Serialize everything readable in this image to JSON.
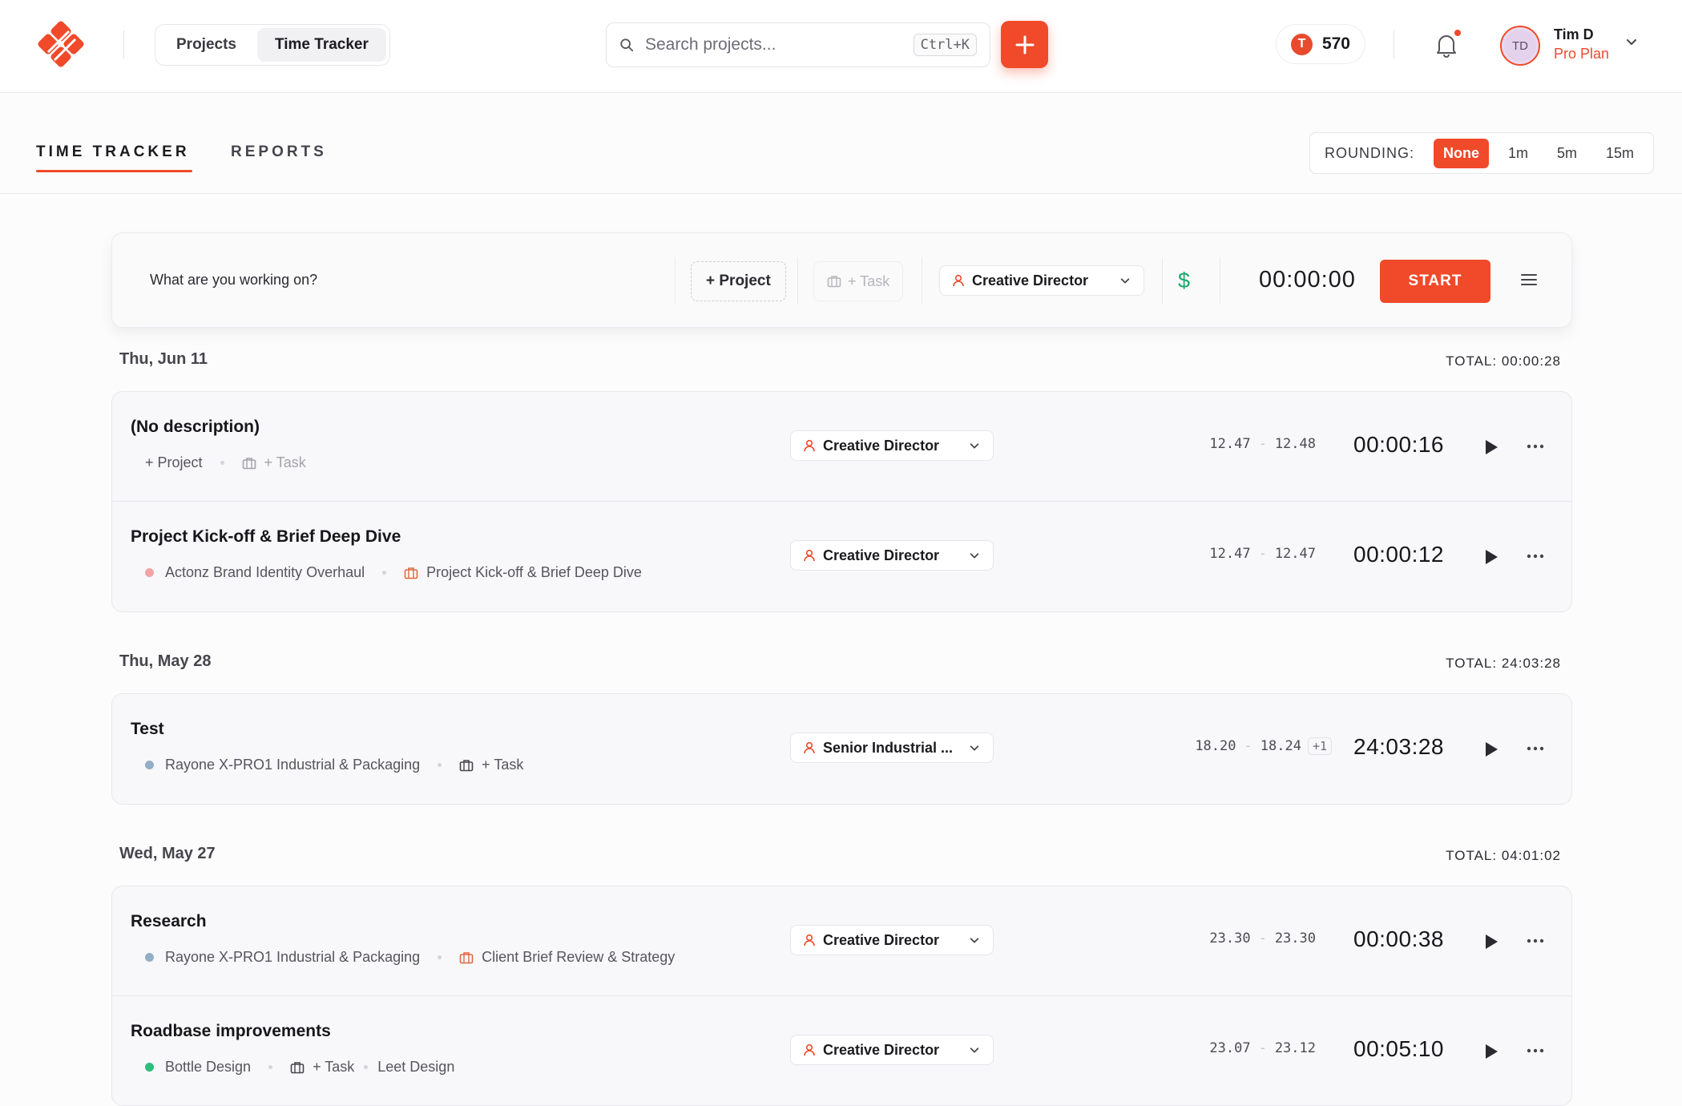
{
  "colors": {
    "accent": "#f04a2a",
    "money": "#1ca66b"
  },
  "header": {
    "nav": [
      {
        "label": "Projects"
      },
      {
        "label": "Time Tracker"
      }
    ],
    "search": {
      "placeholder": "Search projects...",
      "shortcut": "Ctrl+K"
    },
    "coins": {
      "icon": "T",
      "value": "570"
    },
    "user": {
      "initials": "TD",
      "name": "Tim D",
      "plan": "Pro Plan"
    }
  },
  "subnav": {
    "tabs": [
      {
        "label": "TIME TRACKER"
      },
      {
        "label": "REPORTS"
      }
    ],
    "rounding": {
      "label": "ROUNDING:",
      "options": [
        "None",
        "1m",
        "5m",
        "15m"
      ],
      "selected": "None"
    }
  },
  "timer": {
    "prompt": "What are you working on?",
    "project_label": "+ Project",
    "task_label": "+ Task",
    "role": "Creative Director",
    "billable_icon": "$",
    "time": "00:00:00",
    "start_label": "START"
  },
  "groups": [
    {
      "date": "Thu, Jun 11",
      "total": "TOTAL: 00:00:28",
      "entries": [
        {
          "title": "(No description)",
          "project": "+ Project",
          "task": "+ Task",
          "role": "Creative Director",
          "start": "12.47",
          "end": "12.48",
          "duration": "00:00:16"
        },
        {
          "title": "Project Kick-off & Brief Deep Dive",
          "project": "Actonz Brand Identity Overhaul",
          "project_color": "#f1a3a8",
          "task": "Project Kick-off & Brief Deep Dive",
          "role": "Creative Director",
          "start": "12.47",
          "end": "12.47",
          "duration": "00:00:12"
        }
      ]
    },
    {
      "date": "Thu, May 28",
      "total": "TOTAL: 24:03:28",
      "entries": [
        {
          "title": "Test",
          "project": "Rayone X-PRO1 Industrial & Packaging",
          "project_color": "#93aec7",
          "task": "+ Task",
          "role": "Senior Industrial ...",
          "start": "18.20",
          "end": "18.24",
          "extra": "+1",
          "duration": "24:03:28"
        }
      ]
    },
    {
      "date": "Wed, May 27",
      "total": "TOTAL: 04:01:02",
      "entries": [
        {
          "title": "Research",
          "project": "Rayone X-PRO1 Industrial & Packaging",
          "project_color": "#93aec7",
          "task": "Client Brief Review & Strategy",
          "role": "Creative Director",
          "start": "23.30",
          "end": "23.30",
          "duration": "00:00:38"
        },
        {
          "title": "Roadbase improvements",
          "project": "Bottle Design",
          "project_color": "#2ebd7c",
          "task": "+ Task",
          "client": "Leet Design",
          "role": "Creative Director",
          "start": "23.07",
          "end": "23.12",
          "duration": "00:05:10"
        }
      ]
    }
  ]
}
